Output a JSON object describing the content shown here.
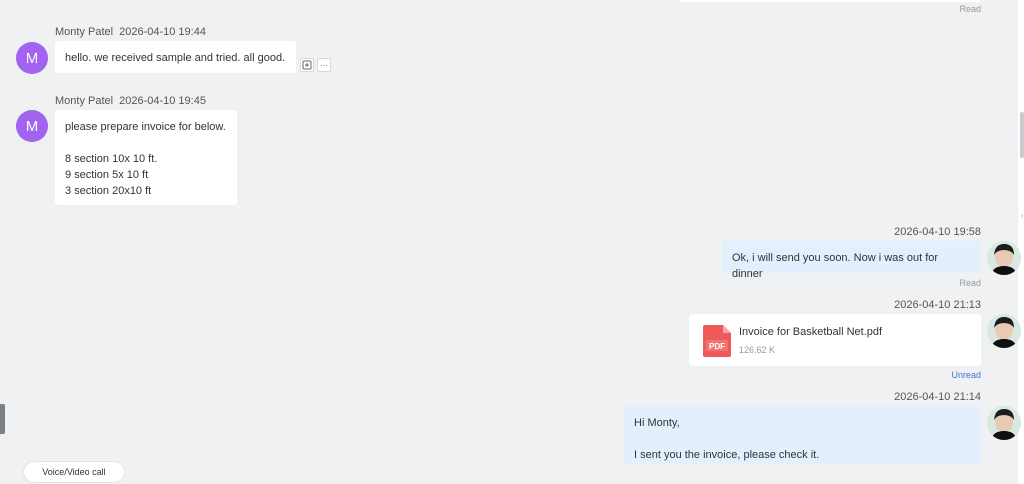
{
  "top": {
    "status": "Read"
  },
  "messages": [
    {
      "sender": "Monty Patel",
      "avatar_initial": "M",
      "time": "2026-04-10 19:44",
      "lines": [
        "hello. we received sample and tried. all good."
      ]
    },
    {
      "sender": "Monty Patel",
      "avatar_initial": "M",
      "time": "2026-04-10 19:45",
      "lines": [
        "please prepare invoice for below.",
        "",
        "8 section 10x 10 ft.",
        "9 section 5x 10 ft",
        "3 section 20x10 ft"
      ]
    }
  ],
  "mine": [
    {
      "time": "2026-04-10 19:58",
      "text": "Ok, i will send you soon. Now i was out for dinner",
      "status": "Read"
    },
    {
      "time": "2026-04-10 21:13",
      "file": {
        "name": "Invoice for Basketball Net.pdf",
        "size": "126.62 K",
        "icon_label": "PDF"
      },
      "status": "Unread"
    },
    {
      "time": "2026-04-10 21:14",
      "lines": [
        "Hi Monty,",
        "",
        "I sent you the invoice, please check it."
      ]
    }
  ],
  "footer": {
    "call_label": "Voice/Video call"
  },
  "colors": {
    "avatar": "#a163f0",
    "mine_bubble": "#e3effc",
    "unread": "#3f74d8",
    "pdf": "#ee5a5a"
  },
  "icons": [
    "add-reaction-icon",
    "more-icon",
    "pdf-file-icon"
  ]
}
